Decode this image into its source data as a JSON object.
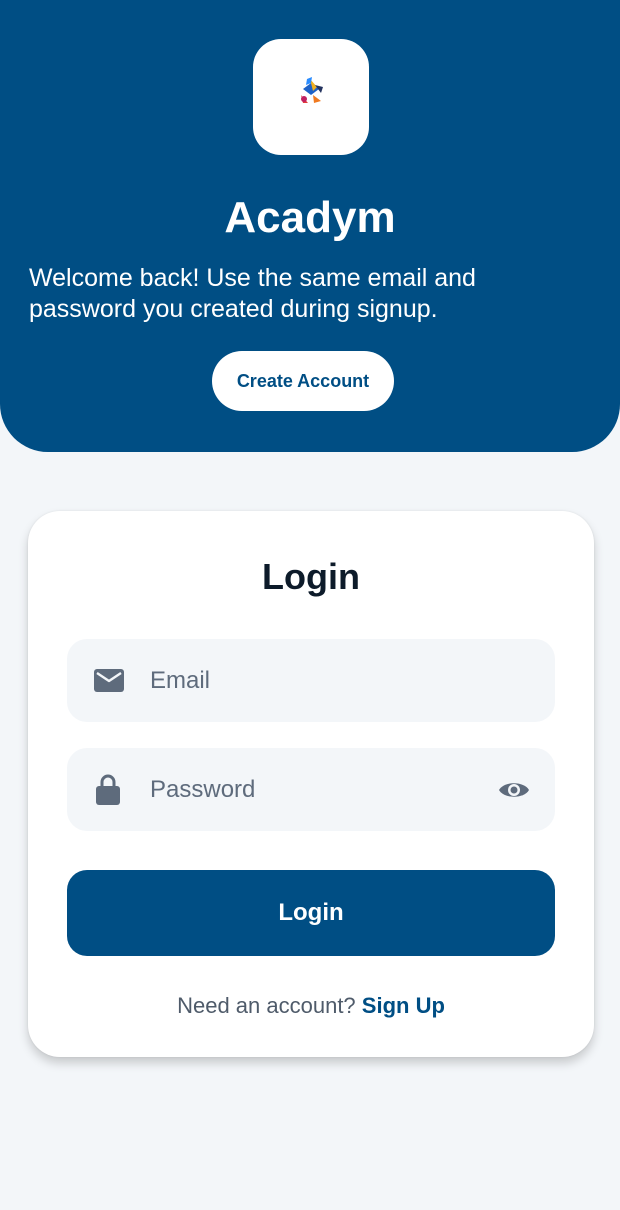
{
  "app": {
    "name": "Acadym",
    "welcome_text": "Welcome back! Use the same email and password you created during signup.",
    "create_account_label": "Create Account",
    "logo_icon": "graduation-cap-logo-icon"
  },
  "login_card": {
    "title": "Login",
    "email": {
      "value": "",
      "placeholder": "Email",
      "icon": "mail-icon"
    },
    "password": {
      "value": "",
      "placeholder": "Password",
      "icon": "lock-icon",
      "toggle_icon": "eye-icon"
    },
    "submit_label": "Login",
    "signup_prompt": "Need an account?",
    "signup_link": "Sign Up"
  },
  "colors": {
    "primary": "#004e84",
    "background": "#f3f6f9",
    "card": "#ffffff",
    "field_background": "#f3f6f9",
    "icon": "#5e6b7c"
  }
}
